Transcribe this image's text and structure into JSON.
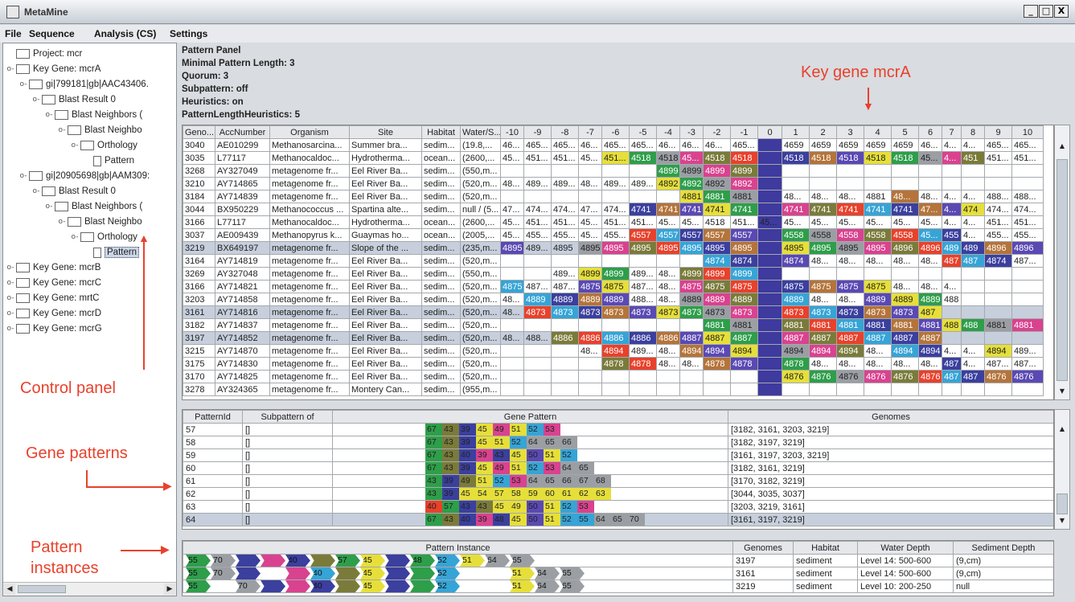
{
  "window": {
    "title": "MetaMine",
    "buttons": [
      "_",
      "□",
      "X"
    ]
  },
  "menu": [
    "File",
    "Sequence",
    "Analysis (CS)",
    "Settings"
  ],
  "tree": [
    {
      "label": "Project: mcr",
      "depth": 0,
      "type": "folder",
      "exp": ""
    },
    {
      "label": "Key Gene: mcrA",
      "depth": 0,
      "type": "folder",
      "exp": "o-"
    },
    {
      "label": "gi|799181|gb|AAC43406.",
      "depth": 1,
      "type": "folder",
      "exp": "o-"
    },
    {
      "label": "Blast Result 0",
      "depth": 2,
      "type": "folder",
      "exp": "o-"
    },
    {
      "label": "Blast Neighbors (",
      "depth": 3,
      "type": "folder",
      "exp": "o-"
    },
    {
      "label": "Blast Neighbo",
      "depth": 4,
      "type": "folder",
      "exp": "o-"
    },
    {
      "label": "Orthology",
      "depth": 5,
      "type": "folder",
      "exp": "o-"
    },
    {
      "label": "Pattern",
      "depth": 6,
      "type": "file",
      "exp": ""
    },
    {
      "label": "gi|20905698|gb|AAM309:",
      "depth": 1,
      "type": "folder",
      "exp": "o-"
    },
    {
      "label": "Blast Result 0",
      "depth": 2,
      "type": "folder",
      "exp": "o-"
    },
    {
      "label": "Blast Neighbors (",
      "depth": 3,
      "type": "folder",
      "exp": "o-"
    },
    {
      "label": "Blast Neighbo",
      "depth": 4,
      "type": "folder",
      "exp": "o-"
    },
    {
      "label": "Orthology",
      "depth": 5,
      "type": "folder",
      "exp": "o-"
    },
    {
      "label": "Pattern",
      "depth": 6,
      "type": "file",
      "exp": "",
      "selected": true
    },
    {
      "label": "Key Gene: mcrB",
      "depth": 0,
      "type": "folder",
      "exp": "o-"
    },
    {
      "label": "Key Gene: mcrC",
      "depth": 0,
      "type": "folder",
      "exp": "o-"
    },
    {
      "label": "Key Gene: mrtC",
      "depth": 0,
      "type": "folder",
      "exp": "o-"
    },
    {
      "label": "Key Gene: mcrD",
      "depth": 0,
      "type": "folder",
      "exp": "o-"
    },
    {
      "label": "Key Gene: mcrG",
      "depth": 0,
      "type": "folder",
      "exp": "o-"
    }
  ],
  "annotations": {
    "key_gene": "Key gene mcrA",
    "control_panel": "Control panel",
    "gene_patterns": "Gene patterns",
    "pattern_instances": "Pattern\ninstances"
  },
  "pattern_panel": {
    "lines": [
      "Pattern Panel",
      "Minimal Pattern Length: 3",
      "Quorum: 3",
      "Subpattern: off",
      "Heuristics: on",
      "PatternLengthHeuristics: 5"
    ]
  },
  "genome_table": {
    "headers": [
      "Geno...",
      "AccNumber",
      "Organism",
      "Site",
      "Habitat",
      "Water/S...",
      "-10",
      "-9",
      "-8",
      "-7",
      "-6",
      "-5",
      "-4",
      "-3",
      "-2",
      "-1",
      "0",
      "1",
      "2",
      "3",
      "4",
      "5",
      "6",
      "7",
      "8",
      "9",
      "10"
    ],
    "rows": [
      [
        "3040",
        "AE010299",
        "Methanosarcina...",
        "Summer bra...",
        "sedim...",
        "(19.8,...",
        "46...",
        "465...",
        "465...",
        "46...",
        "465...",
        "465...",
        "46...",
        "46...",
        "46...",
        "465...",
        "",
        "4659",
        "4659",
        "4659",
        "4659",
        "4659",
        "46...",
        "4...",
        "4...",
        "465...",
        "465..."
      ],
      [
        "3035",
        "L77117",
        "Methanocaldoc...",
        "Hydrotherma...",
        "ocean...",
        "(2600,...",
        "45...",
        "451...",
        "451...",
        "45...",
        "451...",
        "4518",
        "4518",
        "45...",
        "4518",
        "4518",
        "",
        "4518",
        "4518",
        "4518",
        "4518",
        "4518",
        "45...",
        "4...",
        "451",
        "451...",
        "451..."
      ],
      [
        "3268",
        "AY327049",
        "metagenome fr...",
        "Eel River Ba...",
        "sedim...",
        "(550,m...",
        "",
        "",
        "",
        "",
        "",
        "",
        "4899",
        "4899",
        "4899",
        "4899",
        "",
        "",
        "",
        "",
        "",
        "",
        "",
        "",
        "",
        "",
        ""
      ],
      [
        "3210",
        "AY714865",
        "metagenome fr...",
        "Eel River Ba...",
        "sedim...",
        "(520,m...",
        "48...",
        "489...",
        "489...",
        "48...",
        "489...",
        "489...",
        "4892",
        "4892",
        "4892",
        "4892",
        "",
        "",
        "",
        "",
        "",
        "",
        "",
        "",
        "",
        "",
        ""
      ],
      [
        "3184",
        "AY714839",
        "metagenome fr...",
        "Eel River Ba...",
        "sedim...",
        "(520,m...",
        "",
        "",
        "",
        "",
        "",
        "",
        "",
        "4881",
        "4881",
        "4881",
        "",
        "48...",
        "48...",
        "48...",
        "4881",
        "48...",
        "48...",
        "4...",
        "4...",
        "488...",
        "488..."
      ],
      [
        "3044",
        "BX950229",
        "Methanococcus ...",
        "Spartina alte...",
        "sedim...",
        "null / (5...",
        "47...",
        "474...",
        "474...",
        "47...",
        "474...",
        "4741",
        "4741",
        "4741",
        "4741",
        "4741",
        "",
        "4741",
        "4741",
        "4741",
        "4741",
        "4741",
        "47...",
        "4...",
        "474",
        "474...",
        "474..."
      ],
      [
        "3166",
        "L77117",
        "Methanocaldoc...",
        "Hydrotherma...",
        "ocean...",
        "(2600,...",
        "45...",
        "451...",
        "451...",
        "45...",
        "451...",
        "451...",
        "45...",
        "45...",
        "4518",
        "451...",
        "45...",
        "45...",
        "45...",
        "45...",
        "45...",
        "45...",
        "45...",
        "4...",
        "4...",
        "451...",
        "451..."
      ],
      [
        "3037",
        "AE009439",
        "Methanopyrus k...",
        "Guaymas ho...",
        "ocean...",
        "(2005,...",
        "45...",
        "455...",
        "455...",
        "45...",
        "455...",
        "4557",
        "4557",
        "4557",
        "4557",
        "4557",
        "",
        "4558",
        "4558",
        "4558",
        "4558",
        "4558",
        "45...",
        "455",
        "4...",
        "455...",
        "455..."
      ],
      [
        "3219",
        "BX649197",
        "metagenome fr...",
        "Slope of the ...",
        "sedim...",
        "(235,m...",
        "4895",
        "489...",
        "4895",
        "4895",
        "4895",
        "4895",
        "4895",
        "4895",
        "4895",
        "4895",
        "",
        "4895",
        "4895",
        "4895",
        "4895",
        "4896",
        "4896",
        "489",
        "489",
        "4896",
        "4896"
      ],
      [
        "3164",
        "AY714819",
        "metagenome fr...",
        "Eel River Ba...",
        "sedim...",
        "(520,m...",
        "",
        "",
        "",
        "",
        "",
        "",
        "",
        "",
        "4874",
        "4874",
        "",
        "4874",
        "48...",
        "48...",
        "48...",
        "48...",
        "48...",
        "487",
        "487",
        "4874",
        "487..."
      ],
      [
        "3269",
        "AY327048",
        "metagenome fr...",
        "Eel River Ba...",
        "sedim...",
        "(550,m...",
        "",
        "",
        "489...",
        "4899",
        "4899",
        "489...",
        "48...",
        "4899",
        "4899",
        "4899",
        "",
        "",
        "",
        "",
        "",
        "",
        "",
        "",
        "",
        "",
        ""
      ],
      [
        "3166",
        "AY714821",
        "metagenome fr...",
        "Eel River Ba...",
        "sedim...",
        "(520,m...",
        "4875",
        "487...",
        "487...",
        "4875",
        "4875",
        "487...",
        "48...",
        "4875",
        "4875",
        "4875",
        "",
        "4875",
        "4875",
        "4875",
        "4875",
        "48...",
        "48...",
        "4...",
        "",
        "",
        ""
      ],
      [
        "3203",
        "AY714858",
        "metagenome fr...",
        "Eel River Ba...",
        "sedim...",
        "(520,m...",
        "48...",
        "4889",
        "4889",
        "4889",
        "4889",
        "488...",
        "48...",
        "4889",
        "4889",
        "4889",
        "",
        "4889",
        "48...",
        "48...",
        "4889",
        "4889",
        "4889",
        "488",
        "",
        "",
        ""
      ],
      [
        "3161",
        "AY714816",
        "metagenome fr...",
        "Eel River Ba...",
        "sedim...",
        "(520,m...",
        "48...",
        "4873",
        "4873",
        "4873",
        "4873",
        "4873",
        "4873",
        "4873",
        "4873",
        "4873",
        "",
        "4873",
        "4873",
        "4873",
        "4873",
        "4873",
        "487",
        "",
        "",
        "",
        ""
      ],
      [
        "3182",
        "AY714837",
        "metagenome fr...",
        "Eel River Ba...",
        "sedim...",
        "(520,m...",
        "",
        "",
        "",
        "",
        "",
        "",
        "",
        "",
        "4881",
        "4881",
        "",
        "4881",
        "4881",
        "4881",
        "4881",
        "4881",
        "4881",
        "488",
        "488",
        "4881",
        "4881"
      ],
      [
        "3197",
        "AY714852",
        "metagenome fr...",
        "Eel River Ba...",
        "sedim...",
        "(520,m...",
        "48...",
        "488...",
        "4886",
        "4886",
        "4886",
        "4886",
        "4886",
        "4887",
        "4887",
        "4887",
        "",
        "4887",
        "4887",
        "4887",
        "4887",
        "4887",
        "4887",
        "",
        "",
        "",
        ""
      ],
      [
        "3215",
        "AY714870",
        "metagenome fr...",
        "Eel River Ba...",
        "sedim...",
        "(520,m...",
        "",
        "",
        "",
        "48...",
        "4894",
        "489...",
        "48...",
        "4894",
        "4894",
        "4894",
        "",
        "4894",
        "4894",
        "4894",
        "48...",
        "4894",
        "4894",
        "4...",
        "4...",
        "4894",
        "489..."
      ],
      [
        "3175",
        "AY714830",
        "metagenome fr...",
        "Eel River Ba...",
        "sedim...",
        "(520,m...",
        "",
        "",
        "",
        "",
        "4878",
        "4878",
        "48...",
        "48...",
        "4878",
        "4878",
        "",
        "4878",
        "48...",
        "48...",
        "48...",
        "48...",
        "48...",
        "487",
        "4...",
        "487...",
        "487..."
      ],
      [
        "3170",
        "AY714825",
        "metagenome fr...",
        "Eel River Ba...",
        "sedim...",
        "(520,m...",
        "",
        "",
        "",
        "",
        "",
        "",
        "",
        "",
        "",
        "",
        "",
        "4876",
        "4876",
        "4876",
        "4876",
        "4876",
        "4876",
        "487",
        "487",
        "4876",
        "4876"
      ],
      [
        "3278",
        "AY324365",
        "metagenome fr...",
        "Montery Can...",
        "sedim...",
        "(955,m...",
        "",
        "",
        "",
        "",
        "",
        "",
        "",
        "",
        "",
        "",
        "",
        "",
        "",
        "",
        "",
        "",
        "",
        "",
        "",
        "",
        ""
      ]
    ],
    "selected_rows": [
      8,
      13,
      15
    ]
  },
  "pattern_table": {
    "headers": [
      "PatternId",
      "Subpattern of",
      "Gene Pattern",
      "Genomes"
    ],
    "rows": [
      {
        "id": "57",
        "sub": "[]",
        "genes": [
          "67",
          "43",
          "39",
          "45",
          "49",
          "51",
          "52",
          "53"
        ],
        "colors": [
          "#2e9e4a",
          "#7a7b3a",
          "#3b3f9e",
          "#e6df3a",
          "#d9428f",
          "#e6df3a",
          "#36a4d6",
          "#d9428f"
        ],
        "genomes": "[3182, 3161, 3203, 3219]"
      },
      {
        "id": "58",
        "sub": "[]",
        "genes": [
          "67",
          "43",
          "39",
          "45",
          "51",
          "52",
          "64",
          "65",
          "66"
        ],
        "colors": [
          "#2e9e4a",
          "#7a7b3a",
          "#3b3f9e",
          "#e6df3a",
          "#e6df3a",
          "#36a4d6",
          "#9b9fa4",
          "#9b9fa4",
          "#9b9fa4"
        ],
        "genomes": "[3182, 3197, 3219]"
      },
      {
        "id": "59",
        "sub": "[]",
        "genes": [
          "67",
          "43",
          "40",
          "39",
          "43",
          "45",
          "50",
          "51",
          "52"
        ],
        "colors": [
          "#2e9e4a",
          "#7a7b3a",
          "#3b3f9e",
          "#d9428f",
          "#3b3f9e",
          "#e6df3a",
          "#5a49b3",
          "#e6df3a",
          "#36a4d6"
        ],
        "genomes": "[3161, 3197, 3203, 3219]"
      },
      {
        "id": "60",
        "sub": "[]",
        "genes": [
          "67",
          "43",
          "39",
          "45",
          "49",
          "51",
          "52",
          "53",
          "64",
          "65"
        ],
        "colors": [
          "#2e9e4a",
          "#7a7b3a",
          "#3b3f9e",
          "#e6df3a",
          "#d9428f",
          "#e6df3a",
          "#36a4d6",
          "#d9428f",
          "#9b9fa4",
          "#9b9fa4"
        ],
        "genomes": "[3182, 3161, 3219]"
      },
      {
        "id": "61",
        "sub": "[]",
        "genes": [
          "43",
          "39",
          "49",
          "51",
          "52",
          "53",
          "64",
          "65",
          "66",
          "67",
          "68"
        ],
        "colors": [
          "#2e9e4a",
          "#3b3f9e",
          "#7a7b3a",
          "#e6df3a",
          "#36a4d6",
          "#d9428f",
          "#9b9fa4",
          "#9b9fa4",
          "#9b9fa4",
          "#9b9fa4",
          "#9b9fa4"
        ],
        "genomes": "[3170, 3182, 3219]"
      },
      {
        "id": "62",
        "sub": "[]",
        "genes": [
          "43",
          "39",
          "45",
          "54",
          "57",
          "58",
          "59",
          "60",
          "61",
          "62",
          "63"
        ],
        "colors": [
          "#2e9e4a",
          "#3b3f9e",
          "#e6df3a",
          "#e6df3a",
          "#e6df3a",
          "#e6df3a",
          "#e6df3a",
          "#e6df3a",
          "#e6df3a",
          "#e6df3a",
          "#e6df3a"
        ],
        "genomes": "[3044, 3035, 3037]"
      },
      {
        "id": "63",
        "sub": "[]",
        "genes": [
          "40",
          "57",
          "43",
          "43",
          "45",
          "49",
          "50",
          "51",
          "52",
          "53"
        ],
        "colors": [
          "#e8412c",
          "#2e9e4a",
          "#3b3f9e",
          "#7a7b3a",
          "#e6df3a",
          "#e6df3a",
          "#5a49b3",
          "#e6df3a",
          "#36a4d6",
          "#d9428f"
        ],
        "genomes": "[3203, 3219, 3161]"
      },
      {
        "id": "64",
        "sub": "[]",
        "genes": [
          "67",
          "43",
          "40",
          "39",
          "48",
          "45",
          "50",
          "51",
          "52",
          "55",
          "64",
          "65",
          "70"
        ],
        "colors": [
          "#2e9e4a",
          "#7a7b3a",
          "#3b3f9e",
          "#d9428f",
          "#3b3f9e",
          "#e6df3a",
          "#5a49b3",
          "#e6df3a",
          "#36a4d6",
          "#36a4d6",
          "#9b9fa4",
          "#9b9fa4",
          "#9b9fa4"
        ],
        "genomes": "[3161, 3197, 3219]",
        "selected": true
      }
    ]
  },
  "instance_table": {
    "headers": [
      "Pattern Instance",
      "Genomes",
      "Habitat",
      "Water Depth",
      "Sediment Depth"
    ],
    "rows": [
      {
        "genes": [
          "55",
          "70",
          "",
          "",
          "40",
          "",
          "57",
          "45",
          "",
          "48",
          "52",
          "51",
          "64",
          "65"
        ],
        "colors": [
          "#2e9e4a",
          "#9b9fa4",
          "#3b3f9e",
          "#d9428f",
          "#3b3f9e",
          "#7a7b3a",
          "#2e9e4a",
          "#e6df3a",
          "#3b3f9e",
          "#2e9e4a",
          "#36a4d6",
          "#e6df3a",
          "#9b9fa4",
          "#9b9fa4"
        ],
        "genome": "3197",
        "habitat": "sediment",
        "water": "Level 14: 500-600",
        "sediment": "(9,cm)"
      },
      {
        "genes": [
          "55",
          "70",
          "",
          "",
          "",
          "40",
          "",
          "45",
          "",
          "",
          "52",
          "",
          "",
          "51",
          "64",
          "65"
        ],
        "colors": [
          "#2e9e4a",
          "#9b9fa4",
          "#3b3f9e",
          "#ffffff",
          "#d9428f",
          "#36a4d6",
          "#7a7b3a",
          "#e6df3a",
          "#3b3f9e",
          "#2e9e4a",
          "#36a4d6",
          "#ffffff",
          "#ffffff",
          "#e6df3a",
          "#9b9fa4",
          "#9b9fa4"
        ],
        "genome": "3161",
        "habitat": "sediment",
        "water": "Level 14: 500-600",
        "sediment": "(9,cm)"
      },
      {
        "genes": [
          "55",
          "",
          "70",
          "",
          "",
          "40",
          "",
          "45",
          "",
          "",
          "52",
          "",
          "",
          "51",
          "64",
          "65"
        ],
        "colors": [
          "#2e9e4a",
          "#ffffff",
          "#9b9fa4",
          "#3b3f9e",
          "#d9428f",
          "#3b3f9e",
          "#7a7b3a",
          "#e6df3a",
          "#3b3f9e",
          "#2e9e4a",
          "#36a4d6",
          "#ffffff",
          "#ffffff",
          "#e6df3a",
          "#9b9fa4",
          "#9b9fa4"
        ],
        "genome": "3219",
        "habitat": "sediment",
        "water": "Level 10: 200-250",
        "sediment": "null"
      }
    ]
  },
  "colors": {
    "green": "#2e9e4a",
    "olive": "#7a7b3a",
    "navy": "#3b3f9e",
    "yellow": "#e6df3a",
    "magenta": "#d9428f",
    "cyan": "#36a4d6",
    "purple": "#5a49b3",
    "gray": "#9b9fa4",
    "red": "#e8412c",
    "brown": "#b4743a",
    "key_column": "#3e3a9e",
    "annotation": "#e8412c"
  }
}
